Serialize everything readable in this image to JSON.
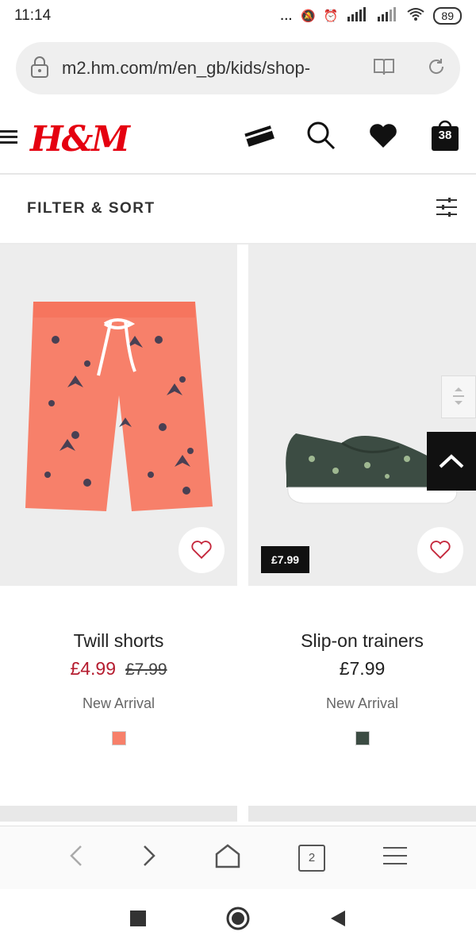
{
  "status": {
    "time": "11:14",
    "battery": "89",
    "dots": "..."
  },
  "browser": {
    "url": "m2.hm.com/m/en_gb/kids/shop-",
    "tab_count": "2"
  },
  "header": {
    "logo": "H&M",
    "bag_count": "38"
  },
  "filter": {
    "label": "FILTER & SORT"
  },
  "products": [
    {
      "name": "Twill shorts",
      "price": "£4.99",
      "old_price": "£7.99",
      "badge": "New Arrival",
      "swatch": "#f7806a"
    },
    {
      "name": "Slip-on trainers",
      "price": "£7.99",
      "price_tag": "£7.99",
      "badge": "New Arrival",
      "swatch": "#3c4c43"
    }
  ],
  "colors": {
    "brand": "#e50010",
    "sale": "#b51c2f"
  }
}
